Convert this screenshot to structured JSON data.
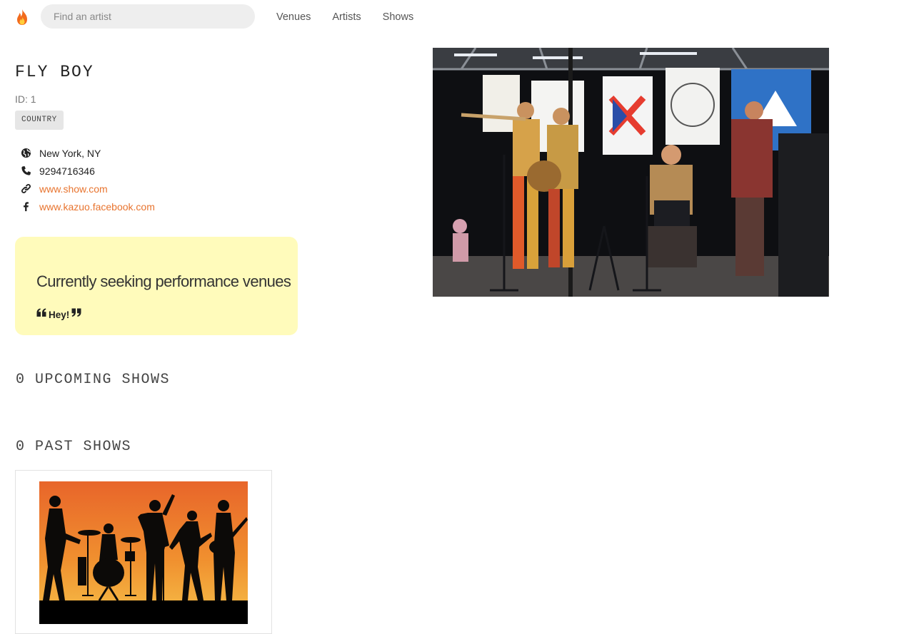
{
  "navbar": {
    "logo_icon": "flame-icon",
    "search_placeholder": "Find an artist",
    "links": [
      "Venues",
      "Artists",
      "Shows"
    ]
  },
  "artist": {
    "name": "FLY BOY",
    "id_label": "ID: 1",
    "genre": "COUNTRY",
    "location": "New York, NY",
    "phone": "9294716346",
    "website": "www.show.com",
    "facebook": "www.kazuo.facebook.com",
    "icons": [
      "globe-icon",
      "phone-icon",
      "link-icon",
      "facebook-icon"
    ]
  },
  "seeking": {
    "title": "Currently seeking performance venues",
    "quote": "Hey!",
    "background": "#fffbbb"
  },
  "shows": {
    "upcoming_title": "0 UPCOMING SHOWS",
    "past_title": "0 PAST SHOWS"
  },
  "colors": {
    "link": "#e8742f",
    "accent_flame": "#f26b1d"
  }
}
